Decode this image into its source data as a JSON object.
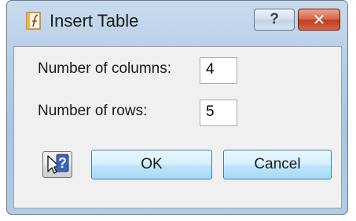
{
  "window": {
    "title": "Insert Table",
    "help_glyph": "?",
    "close_glyph": "✕",
    "app_icon": "formula-doc-icon"
  },
  "form": {
    "columns_label": "Number of columns:",
    "columns_value": "4",
    "rows_label": "Number of rows:",
    "rows_value": "5"
  },
  "buttons": {
    "context_help_icon": "pointer-question-icon",
    "ok_label": "OK",
    "cancel_label": "Cancel"
  },
  "colors": {
    "title_bar": "#b6cde6",
    "close_button": "#c1401f",
    "dialog_body": "#f0f0f0",
    "button_highlight": "#bee6fd"
  }
}
